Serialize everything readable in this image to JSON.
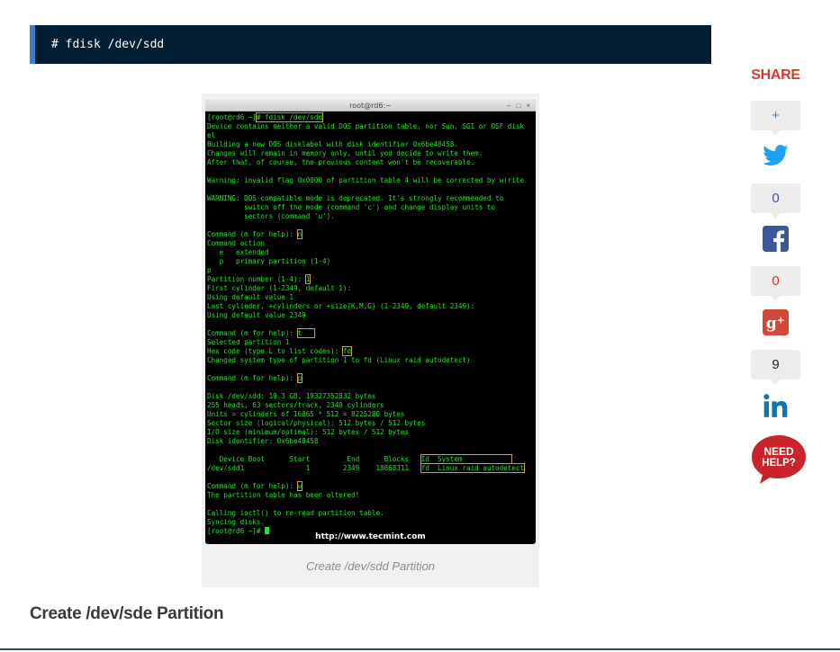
{
  "code_block": {
    "command": "# fdisk /dev/sdd"
  },
  "terminal": {
    "title": "root@rd6:~",
    "controls": [
      "–",
      "□",
      "×"
    ],
    "lines": [
      [
        {
          "t": "[root@rd6 ~]"
        },
        {
          "t": "# fdisk /dev/sdd",
          "hl": true
        }
      ],
      [
        {
          "t": "Device contains neither a valid DOS partition table, nor Sun, SGI or OSF disk"
        }
      ],
      [
        {
          "t": "el"
        }
      ],
      [
        {
          "t": "Building a new DOS disklabel with disk identifier 0x6be48458."
        }
      ],
      [
        {
          "t": "Changes will remain in memory only, until you decide to write them."
        }
      ],
      [
        {
          "t": "After that, of course, the previous content won't be recoverable."
        }
      ],
      [
        {
          "t": ""
        }
      ],
      [
        {
          "t": "Warning: invalid flag 0x0000 of partition table 4 will be corrected by w(rite"
        }
      ],
      [
        {
          "t": ""
        }
      ],
      [
        {
          "t": "WARNING: DOS-compatible mode is deprecated. It's strongly recommended to"
        }
      ],
      [
        {
          "t": "         switch off the mode (command 'c') and change display units to"
        }
      ],
      [
        {
          "t": "         sectors (command 'u')."
        }
      ],
      [
        {
          "t": ""
        }
      ],
      [
        {
          "t": "Command (m for help): "
        },
        {
          "t": "n",
          "hl": true
        }
      ],
      [
        {
          "t": "Command action"
        }
      ],
      [
        {
          "t": "   e   extended"
        }
      ],
      [
        {
          "t": "   p   primary partition (1-4)"
        }
      ],
      [
        {
          "t": "p"
        }
      ],
      [
        {
          "t": "Partition number (1-4): "
        },
        {
          "t": "1",
          "hl": true
        }
      ],
      [
        {
          "t": "First cylinder (1-2349, default 1):"
        }
      ],
      [
        {
          "t": "Using default value 1"
        }
      ],
      [
        {
          "t": "Last cylinder, +cylinders or +size{K,M,G} (1-2349, default 2349):"
        }
      ],
      [
        {
          "t": "Using default value 2349"
        }
      ],
      [
        {
          "t": ""
        }
      ],
      [
        {
          "t": "Command (m for help): "
        },
        {
          "t": "t   ",
          "hl": true
        }
      ],
      [
        {
          "t": "Selected partition 1"
        }
      ],
      [
        {
          "t": "Hex code (type L to list codes): "
        },
        {
          "t": "fd",
          "hl": true
        }
      ],
      [
        {
          "t": "Changed system type of partition 1 to fd (Linux raid autodetect)"
        }
      ],
      [
        {
          "t": ""
        }
      ],
      [
        {
          "t": "Command (m for help): "
        },
        {
          "t": "p",
          "hl": true
        }
      ],
      [
        {
          "t": ""
        }
      ],
      [
        {
          "t": "Disk /dev/sdd: 19.3 GB, 19327352832 bytes"
        }
      ],
      [
        {
          "t": "255 heads, 63 sectors/track, 2349 cylinders"
        }
      ],
      [
        {
          "t": "Units = cylinders of 16065 * 512 = 8225280 bytes"
        }
      ],
      [
        {
          "t": "Sector size (logical/physical): 512 bytes / 512 bytes"
        }
      ],
      [
        {
          "t": "I/O size (minimum/optimal): 512 bytes / 512 bytes"
        }
      ],
      [
        {
          "t": "Disk identifier: 0x6be48458"
        }
      ],
      [
        {
          "t": ""
        }
      ],
      [
        {
          "t": "   Device Boot      Start         End      Blocks   "
        },
        {
          "t": "Id  System            ",
          "hl": true
        }
      ],
      [
        {
          "t": "/dev/sdd1               1        2349    18868311   "
        },
        {
          "t": "fd  Linux raid autodetect",
          "hl": true
        }
      ],
      [
        {
          "t": ""
        }
      ],
      [
        {
          "t": "Command (m for help): "
        },
        {
          "t": "w",
          "hl": true
        }
      ],
      [
        {
          "t": "The partition table has been altered!"
        }
      ],
      [
        {
          "t": ""
        }
      ],
      [
        {
          "t": "Calling ioctl() to re-read partition table."
        }
      ],
      [
        {
          "t": "Syncing disks."
        }
      ],
      [
        {
          "t": "[root@rd6 ~]# "
        },
        {
          "t": "",
          "cursor": true
        }
      ]
    ],
    "watermark": "http://www.tecmint.com"
  },
  "figure": {
    "caption": "Create /dev/sdd Partition"
  },
  "section": {
    "heading": "Create /dev/sde Partition"
  },
  "share": {
    "title": "SHARE",
    "plus_label": "+",
    "twitter_count": "0",
    "facebook_count": "0",
    "googleplus_count": "9",
    "need_help_line1": "NEED",
    "need_help_line2": "HELP?",
    "colors": {
      "twitter": "#1da1f2",
      "facebook": "#3b5998",
      "googleplus": "#d34836",
      "linkedin": "#0e76a8",
      "share_title": "#d63a2e",
      "need_help": "#c9242a",
      "plus": "#3b82c4",
      "count": "#3b5998",
      "count_red": "#d63a2e",
      "count_dark": "#222222"
    }
  }
}
